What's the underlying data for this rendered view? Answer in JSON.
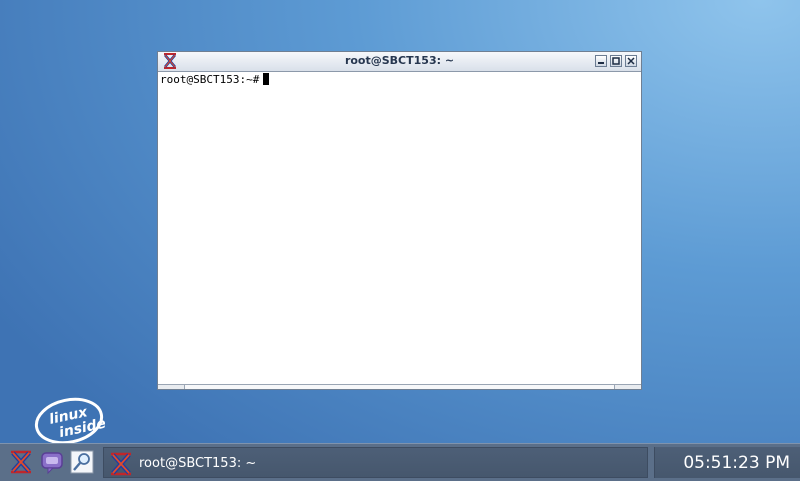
{
  "window": {
    "title": "root@SBCT153: ~",
    "app_icon": "x-terminal-icon",
    "buttons": {
      "minimize": "minimize-icon",
      "maximize": "maximize-icon",
      "close": "close-icon"
    }
  },
  "terminal": {
    "prompt": "root@SBCT153:~#"
  },
  "desktop": {
    "logo_text": [
      "linux",
      "inside"
    ]
  },
  "taskbar": {
    "launchers": [
      "x-terminal-icon",
      "chat-bubble-icon",
      "search-icon"
    ],
    "tasks": [
      {
        "label": "root@SBCT153: ~",
        "icon": "x-terminal-icon"
      }
    ],
    "clock": "05:51:23 PM"
  },
  "colors": {
    "desktop": "#5d9bd4",
    "taskbar": "#5b6f89",
    "titlebar_text": "#26364f"
  }
}
